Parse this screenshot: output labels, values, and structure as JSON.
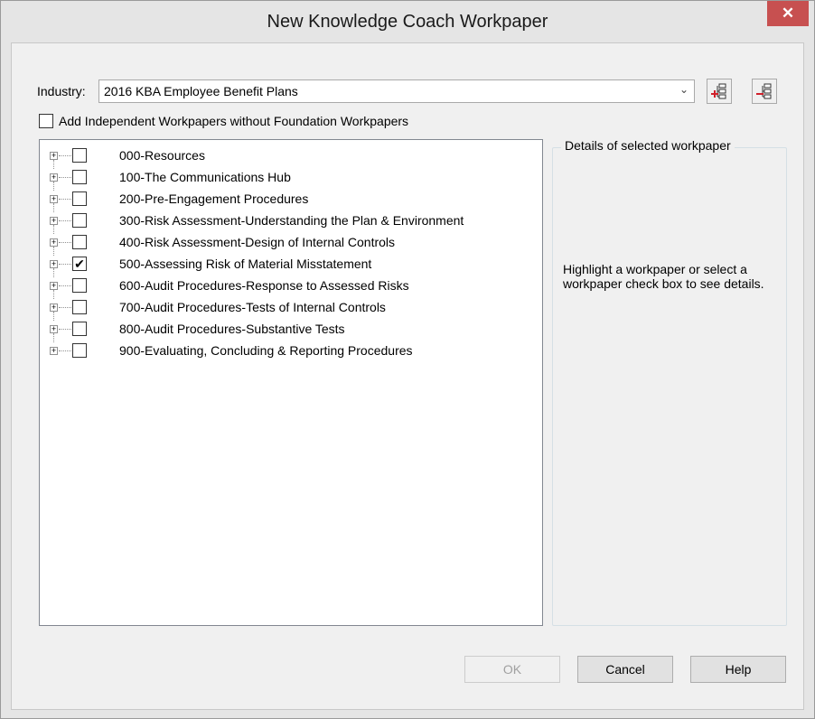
{
  "window": {
    "title": "New Knowledge Coach Workpaper",
    "close_glyph": "✕"
  },
  "industry": {
    "label": "Industry:",
    "selected": "2016 KBA Employee Benefit Plans",
    "dropdown_glyph": "⌄"
  },
  "toolbar": {
    "add_icon": "add-workpaper-icon",
    "remove_icon": "remove-workpaper-icon"
  },
  "independent_option": {
    "label": "Add Independent Workpapers without Foundation Workpapers",
    "checked": false
  },
  "tree": {
    "items": [
      {
        "label": "000-Resources",
        "checked": false
      },
      {
        "label": "100-The Communications Hub",
        "checked": false
      },
      {
        "label": "200-Pre-Engagement Procedures",
        "checked": false
      },
      {
        "label": "300-Risk Assessment-Understanding the Plan & Environment",
        "checked": false
      },
      {
        "label": "400-Risk Assessment-Design of Internal Controls",
        "checked": false
      },
      {
        "label": "500-Assessing Risk of Material Misstatement",
        "checked": true
      },
      {
        "label": "600-Audit Procedures-Response to Assessed Risks",
        "checked": false
      },
      {
        "label": "700-Audit Procedures-Tests of Internal Controls",
        "checked": false
      },
      {
        "label": "800-Audit Procedures-Substantive Tests",
        "checked": false
      },
      {
        "label": "900-Evaluating, Concluding & Reporting Procedures",
        "checked": false
      }
    ]
  },
  "details": {
    "legend": "Details of selected workpaper",
    "hint": "Highlight a workpaper or select a workpaper check box to see details."
  },
  "buttons": {
    "ok": "OK",
    "cancel": "Cancel",
    "help": "Help"
  },
  "colors": {
    "close_button": "#c75050",
    "add_icon_accent": "#d0202a",
    "remove_icon_accent": "#d0202a"
  }
}
